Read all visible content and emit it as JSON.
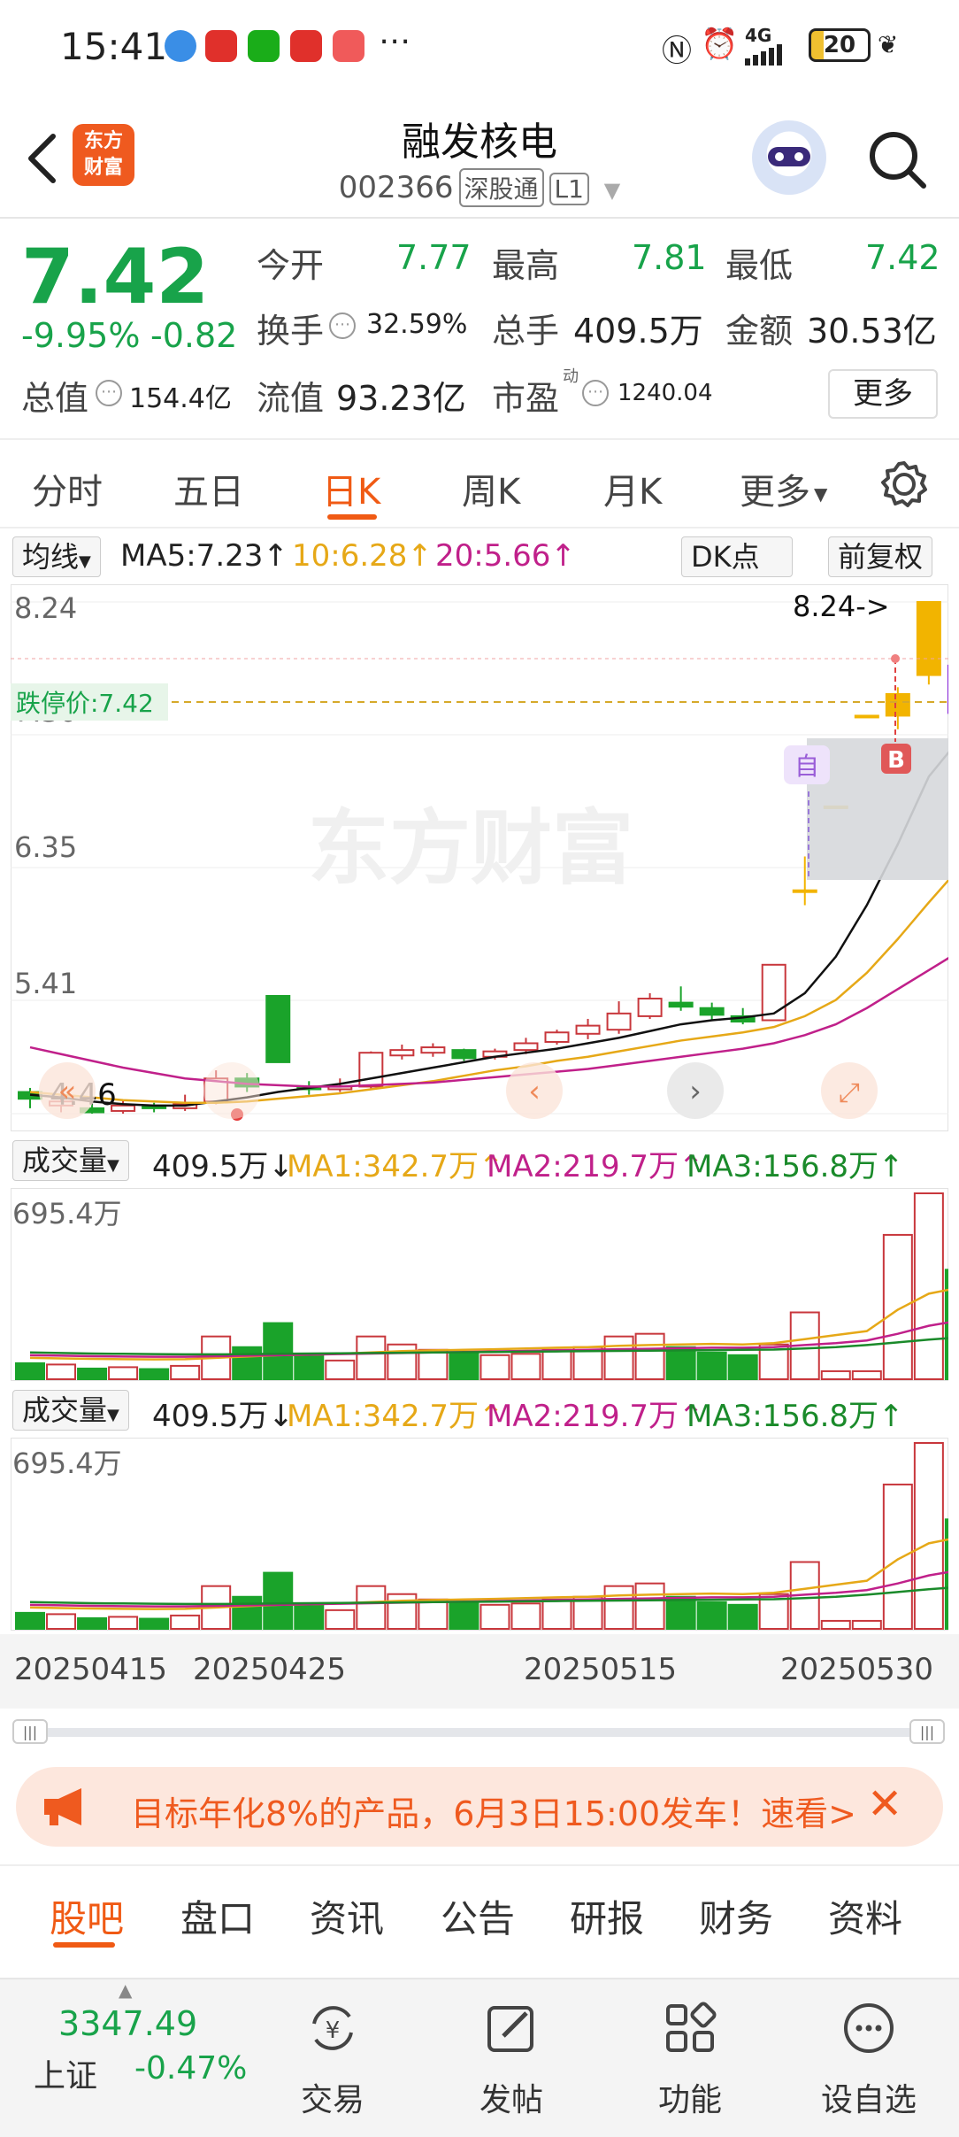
{
  "status_bar": {
    "time": "15:41",
    "network": "4G",
    "battery": "20"
  },
  "header": {
    "back_icon": "chevron-left-icon",
    "logo_text": "东方财富",
    "stock_name": "融发核电",
    "stock_code": "002366",
    "tag_exchange": "深股通",
    "tag_level": "L1",
    "search_icon": "search-icon"
  },
  "quote": {
    "price": "7.42",
    "pct_change": "-9.95%",
    "change": "-0.82",
    "open_label": "今开",
    "open_value": "7.77",
    "high_label": "最高",
    "high_value": "7.81",
    "low_label": "最低",
    "low_value": "7.42",
    "turnover_label": "换手",
    "turnover_value": "32.59%",
    "volume_label": "总手",
    "volume_value": "409.5万",
    "amount_label": "金额",
    "amount_value": "30.53亿",
    "mktcap_label": "总值",
    "mktcap_value": "154.4亿",
    "float_label": "流值",
    "float_value": "93.23亿",
    "pe_label": "市盈",
    "pe_super": "动",
    "pe_value": "1240.04",
    "more_label": "更多"
  },
  "period_tabs": [
    {
      "label": "分时"
    },
    {
      "label": "五日"
    },
    {
      "label": "日K"
    },
    {
      "label": "周K"
    },
    {
      "label": "月K"
    },
    {
      "label": "更多"
    }
  ],
  "ma_bar": {
    "indicator": "均线",
    "ma5": "MA5:7.23↑",
    "ma10": "10:6.28↑",
    "ma20": "20:5.66↑",
    "dk_label": "DK点",
    "adjust_label": "前复权",
    "color_ma5": "#222222",
    "color_ma10": "#e6a817",
    "color_ma20": "#c0208a"
  },
  "kline": {
    "y_labels": [
      "8.24",
      "7.30",
      "6.35",
      "5.41",
      "4.46"
    ],
    "limit_down_label": "跌停价:7.42",
    "high_marker": "8.24->",
    "low_marker": "4.46",
    "self_select_badge": "自",
    "buy_badge": "B",
    "watermark": "东方财富"
  },
  "volume_panels": [
    {
      "indicator": "成交量",
      "vol": "409.5万↓",
      "ma1": "MA1:342.7万↑",
      "ma2": "MA2:219.7万↑",
      "ma3": "MA3:156.8万↑",
      "max_label": "695.4万"
    },
    {
      "indicator": "成交量",
      "vol": "409.5万↓",
      "ma1": "MA1:342.7万↑",
      "ma2": "MA2:219.7万↑",
      "ma3": "MA3:156.8万↑",
      "max_label": "695.4万"
    }
  ],
  "dates": [
    "20250415",
    "20250425",
    "20250515",
    "20250530"
  ],
  "banner": {
    "text": "目标年化8%的产品，6月3日15:00发车！速看>"
  },
  "content_tabs": [
    {
      "label": "股吧"
    },
    {
      "label": "盘口"
    },
    {
      "label": "资讯"
    },
    {
      "label": "公告"
    },
    {
      "label": "研报"
    },
    {
      "label": "财务"
    },
    {
      "label": "资料"
    }
  ],
  "bottom_bar": {
    "index_value": "3347.49",
    "index_name": "上证",
    "index_change": "-0.47%",
    "trade": "交易",
    "post": "发帖",
    "function": "功能",
    "watchlist": "设自选"
  },
  "chart_data": {
    "type": "candlestick",
    "ylim": [
      4.46,
      8.24
    ],
    "candles": [
      {
        "open": 4.62,
        "close": 4.57,
        "high": 4.65,
        "low": 4.5
      },
      {
        "open": 4.52,
        "close": 4.55,
        "high": 4.6,
        "low": 4.47
      },
      {
        "open": 4.5,
        "close": 4.47,
        "high": 4.53,
        "low": 4.46
      },
      {
        "open": 4.48,
        "close": 4.52,
        "high": 4.56,
        "low": 4.46
      },
      {
        "open": 4.52,
        "close": 4.5,
        "high": 4.54,
        "low": 4.47
      },
      {
        "open": 4.5,
        "close": 4.53,
        "high": 4.6,
        "low": 4.48
      },
      {
        "open": 4.55,
        "close": 4.72,
        "high": 4.78,
        "low": 4.53
      },
      {
        "open": 4.72,
        "close": 4.66,
        "high": 4.76,
        "low": 4.62
      },
      {
        "open": 5.33,
        "close": 4.84,
        "high": 5.33,
        "low": 4.84
      },
      {
        "open": 4.66,
        "close": 4.64,
        "high": 4.7,
        "low": 4.6
      },
      {
        "open": 4.64,
        "close": 4.66,
        "high": 4.72,
        "low": 4.62
      },
      {
        "open": 4.66,
        "close": 4.91,
        "high": 4.92,
        "low": 4.64
      },
      {
        "open": 4.89,
        "close": 4.93,
        "high": 4.97,
        "low": 4.86
      },
      {
        "open": 4.91,
        "close": 4.95,
        "high": 4.98,
        "low": 4.88
      },
      {
        "open": 4.93,
        "close": 4.87,
        "high": 4.94,
        "low": 4.85
      },
      {
        "open": 4.88,
        "close": 4.92,
        "high": 4.94,
        "low": 4.86
      },
      {
        "open": 4.93,
        "close": 4.98,
        "high": 5.02,
        "low": 4.9
      },
      {
        "open": 4.99,
        "close": 5.06,
        "high": 5.08,
        "low": 4.97
      },
      {
        "open": 5.05,
        "close": 5.11,
        "high": 5.16,
        "low": 5.01
      },
      {
        "open": 5.08,
        "close": 5.2,
        "high": 5.29,
        "low": 5.05
      },
      {
        "open": 5.18,
        "close": 5.31,
        "high": 5.35,
        "low": 5.16
      },
      {
        "open": 5.28,
        "close": 5.25,
        "high": 5.4,
        "low": 5.22
      },
      {
        "open": 5.24,
        "close": 5.19,
        "high": 5.28,
        "low": 5.15
      },
      {
        "open": 5.18,
        "close": 5.14,
        "high": 5.24,
        "low": 5.12
      },
      {
        "open": 5.15,
        "close": 5.56,
        "high": 5.56,
        "low": 5.15
      },
      {
        "open": 6.11,
        "close": 6.11,
        "high": 6.36,
        "low": 6.0
      },
      {
        "open": 6.73,
        "close": 6.73,
        "high": 6.73,
        "low": 6.73
      },
      {
        "open": 7.4,
        "close": 7.4,
        "high": 7.4,
        "low": 7.4
      },
      {
        "open": 7.4,
        "close": 7.56,
        "high": 7.61,
        "low": 7.3
      },
      {
        "open": 7.7,
        "close": 8.24,
        "high": 8.24,
        "low": 7.63
      },
      {
        "open": 7.77,
        "close": 7.42,
        "high": 7.81,
        "low": 7.42
      }
    ],
    "ma5": [
      4.6,
      4.58,
      4.55,
      4.53,
      4.52,
      4.52,
      4.55,
      4.58,
      4.62,
      4.65,
      4.68,
      4.72,
      4.76,
      4.8,
      4.84,
      4.88,
      4.91,
      4.94,
      4.98,
      5.02,
      5.07,
      5.12,
      5.15,
      5.17,
      5.2,
      5.35,
      5.62,
      6.0,
      6.45,
      6.95,
      7.23
    ],
    "ma10": [
      4.62,
      4.6,
      4.58,
      4.56,
      4.55,
      4.54,
      4.54,
      4.55,
      4.57,
      4.59,
      4.61,
      4.64,
      4.67,
      4.7,
      4.74,
      4.78,
      4.81,
      4.85,
      4.88,
      4.92,
      4.96,
      5.0,
      5.03,
      5.06,
      5.1,
      5.18,
      5.3,
      5.5,
      5.75,
      6.02,
      6.28
    ],
    "ma20": [
      4.95,
      4.9,
      4.85,
      4.8,
      4.76,
      4.72,
      4.7,
      4.68,
      4.67,
      4.66,
      4.66,
      4.67,
      4.68,
      4.69,
      4.71,
      4.73,
      4.75,
      4.77,
      4.79,
      4.82,
      4.85,
      4.88,
      4.91,
      4.94,
      4.98,
      5.04,
      5.12,
      5.24,
      5.38,
      5.52,
      5.66
    ],
    "volume": [
      60,
      55,
      40,
      45,
      38,
      50,
      160,
      120,
      210,
      90,
      70,
      160,
      130,
      110,
      100,
      90,
      95,
      110,
      120,
      160,
      170,
      120,
      100,
      90,
      130,
      250,
      30,
      30,
      540,
      695.4,
      409.5
    ],
    "vol_ma1": [
      80,
      78,
      76,
      75,
      74,
      75,
      80,
      85,
      90,
      92,
      95,
      100,
      105,
      108,
      110,
      112,
      115,
      118,
      120,
      125,
      128,
      130,
      132,
      130,
      135,
      150,
      165,
      180,
      260,
      320,
      342.7
    ],
    "vol_ma2": [
      90,
      88,
      86,
      85,
      84,
      84,
      86,
      88,
      90,
      92,
      94,
      96,
      98,
      100,
      102,
      104,
      106,
      108,
      110,
      112,
      114,
      116,
      118,
      118,
      120,
      128,
      135,
      145,
      170,
      200,
      219.7
    ],
    "vol_ma3": [
      100,
      98,
      96,
      95,
      94,
      93,
      93,
      94,
      95,
      96,
      97,
      98,
      99,
      100,
      101,
      102,
      103,
      104,
      105,
      106,
      107,
      108,
      109,
      110,
      111,
      115,
      120,
      128,
      138,
      148,
      156.8
    ],
    "vol_max": 695.4
  }
}
